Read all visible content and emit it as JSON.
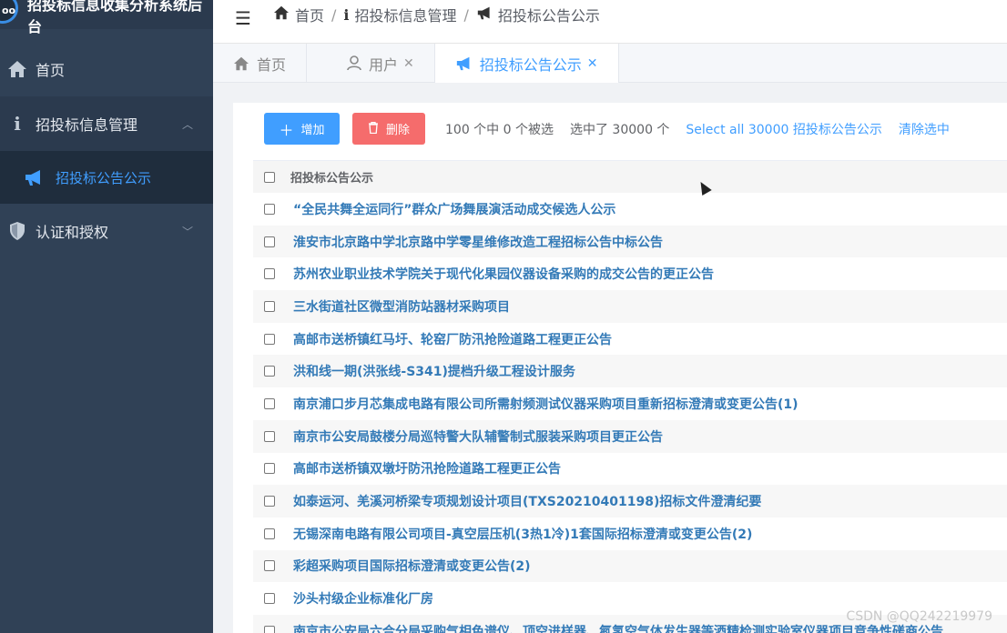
{
  "app": {
    "title": "招投标信息收集分析系统后台",
    "logo_text": "oo"
  },
  "sidebar": {
    "items": [
      {
        "label": "首页",
        "icon": "home-icon"
      },
      {
        "label": "招投标信息管理",
        "icon": "info-icon",
        "expanded": true
      },
      {
        "label": "招投标公告公示",
        "icon": "megaphone-icon",
        "active": true
      },
      {
        "label": "认证和授权",
        "icon": "shield-icon"
      }
    ]
  },
  "header": {
    "breadcrumb": [
      "首页",
      "招投标信息管理",
      "招投标公告公示"
    ]
  },
  "tabs": [
    {
      "label": "首页",
      "icon": "home-icon"
    },
    {
      "label": "用户",
      "icon": "user-icon",
      "closable": true
    },
    {
      "label": "招投标公告公示",
      "icon": "megaphone-icon",
      "closable": true,
      "active": true
    }
  ],
  "toolbar": {
    "add_label": "增加",
    "delete_label": "删除",
    "selection_info": "100 个中 0 个被选",
    "selected_total": "选中了 30000 个",
    "select_all_link": "Select all 30000 招投标公告公示",
    "clear_link": "清除选中"
  },
  "table": {
    "header": "招投标公告公示",
    "rows": [
      "“全民共舞全运同行”群众广场舞展演活动成交候选人公示",
      "淮安市北京路中学北京路中学零星维修改造工程招标公告中标公告",
      "苏州农业职业技术学院关于现代化果园仪器设备采购的成交公告的更正公告",
      "三水街道社区微型消防站器材采购项目",
      "高邮市送桥镇红马圩、轮窑厂防汛抢险道路工程更正公告",
      "洪和线一期(洪张线-S341)提档升级工程设计服务",
      "南京浦口步月芯集成电路有限公司所需射频测试仪器采购项目重新招标澄清或变更公告(1)",
      "南京市公安局鼓楼分局巡特警大队辅警制式服装采购项目更正公告",
      "高邮市送桥镇双墩圩防汛抢险道路工程更正公告",
      "如泰运河、羌溪河桥梁专项规划设计项目(TXS20210401198)招标文件澄清纪要",
      "无锡深南电路有限公司项目-真空层压机(3热1冷)1套国际招标澄清或变更公告(2)",
      "彩超采购项目国际招标澄清或变更公告(2)",
      "沙头村级企业标准化厂房",
      "南京市公安局六合分局采购气相色谱仪、顶空进样器、氮氢空气体发生器等酒精检测实验室仪器项目竞争性磋商公告"
    ]
  },
  "watermark": "CSDN @QQ242219979",
  "colors": {
    "sidebar": "#304156",
    "primary": "#409eff",
    "danger": "#f56c6c"
  }
}
